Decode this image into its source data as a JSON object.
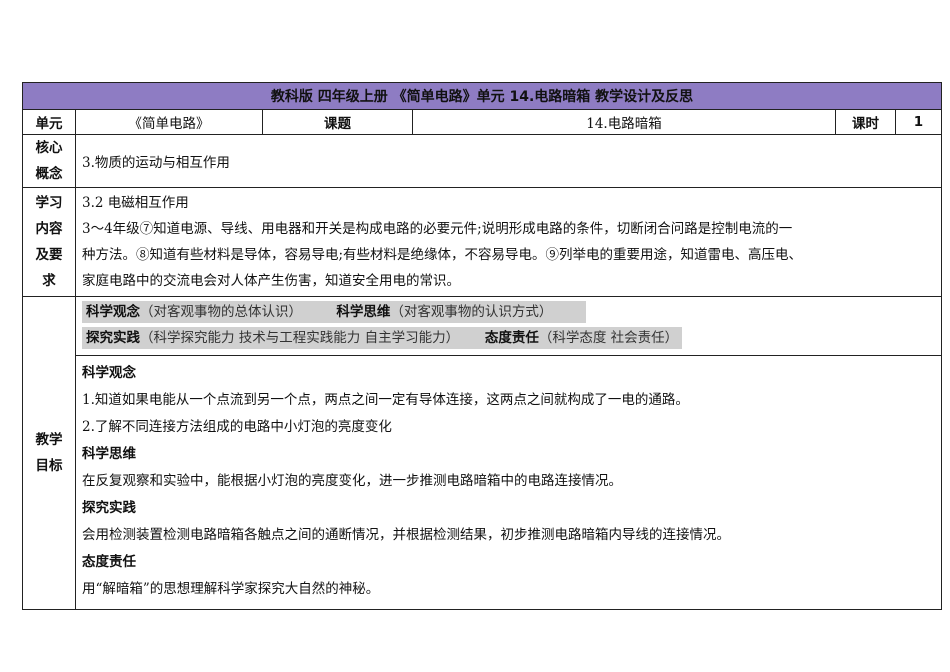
{
  "title": "教科版  四年级上册 《简单电路》单元   14.电路暗箱     教学设计及反思",
  "header": {
    "unit_label": "单元",
    "unit_value": "《简单电路》",
    "topic_label": "课题",
    "topic_value": "14.电路暗箱",
    "hours_label": "课时",
    "hours_value": "1"
  },
  "core": {
    "label_lines": [
      "核心",
      "概念"
    ],
    "value": "3.物质的运动与相互作用"
  },
  "requirements": {
    "label_lines": [
      "学习",
      "内容",
      "及要",
      "求"
    ],
    "lines": [
      "3.2 电磁相互作用",
      "3～4年级⑦知道电源、导线、用电器和开关是构成电路的必要元件;说明形成电路的条件，切断闭合问路是控制电流的一",
      "种方法。⑧知道有些材料是导体，容易导电;有些材料是绝缘体，不容易导电。⑨列举电的重要用途，知道雷电、高压电、",
      "家庭电路中的交流电会对人体产生伤害，知道安全用电的常识。"
    ]
  },
  "goals": {
    "label_lines": [
      "教学",
      "目标"
    ],
    "dimensions": [
      {
        "key": "科学观念",
        "desc": "（对客观事物的总体认识）"
      },
      {
        "key": "科学思维",
        "desc": "（对客观事物的认识方式）"
      },
      {
        "key": "探究实践",
        "desc": "（科学探究能力  技术与工程实践能力  自主学习能力）"
      },
      {
        "key": "态度责任",
        "desc": "（科学态度  社会责任）"
      }
    ],
    "sections": [
      {
        "heading": "科学观念",
        "lines": [
          "1.知道如果电能从一个点流到另一个点，两点之间一定有导体连接，这两点之间就构成了一电的通路。",
          "2.了解不同连接方法组成的电路中小灯泡的亮度变化"
        ]
      },
      {
        "heading": "科学思维",
        "lines": [
          "在反复观察和实验中，能根据小灯泡的亮度变化，进一步推测电路暗箱中的电路连接情况。"
        ]
      },
      {
        "heading": "探究实践",
        "lines": [
          "会用检测装置检测电路暗箱各触点之间的通断情况，并根据检测结果，初步推测电路暗箱内导线的连接情况。"
        ]
      },
      {
        "heading": "态度责任",
        "lines": [
          "用“解暗箱”的思想理解科学家探究大自然的神秘。"
        ]
      }
    ]
  }
}
